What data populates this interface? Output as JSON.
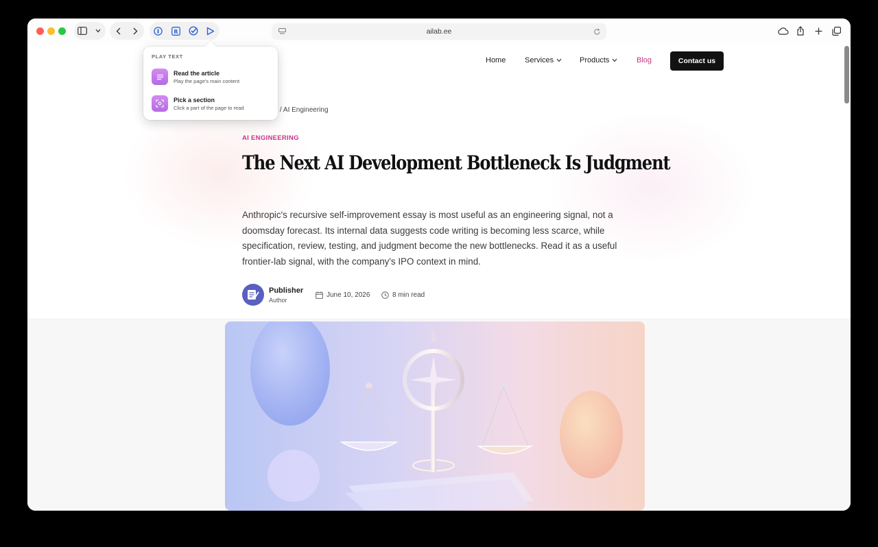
{
  "browser": {
    "url": "ailab.ee"
  },
  "popover": {
    "title": "PLAY TEXT",
    "items": [
      {
        "label": "Read the article",
        "description": "Play the page's main content"
      },
      {
        "label": "Pick a section",
        "description": "Click a part of the page to read"
      }
    ]
  },
  "site_nav": {
    "items": [
      {
        "label": "Home"
      },
      {
        "label": "Services"
      },
      {
        "label": "Products"
      },
      {
        "label": "Blog"
      }
    ],
    "cta_label": "Contact us"
  },
  "breadcrumb": {
    "visible_text": "og  /  AI Engineering"
  },
  "article": {
    "category": "AI ENGINEERING",
    "title": "The Next AI Development Bottleneck Is Judgment",
    "excerpt": "Anthropic's recursive self-improvement essay is most useful as an engineering signal, not a doomsday forecast. Its internal data suggests code writing is becoming less scarce, while specification, review, testing, and judgment become the new bottlenecks. Read it as a useful frontier-lab signal, with the company's IPO context in mind.",
    "author_name": "Publisher",
    "author_role": "Author",
    "date": "June 10, 2026",
    "read_time": "8 min read"
  },
  "colors": {
    "accent": "#c8338a",
    "cta_bg": "#121212",
    "popover_icon": "#c27ae9"
  },
  "icons": [
    "sidebar-icon",
    "chevron-down-icon",
    "back-icon",
    "forward-icon",
    "password-icon",
    "reader-icon",
    "check-icon",
    "play-icon",
    "page-icon",
    "reload-icon",
    "cloud-icon",
    "share-icon",
    "plus-icon",
    "tabs-icon",
    "lines-icon",
    "target-icon",
    "calendar-icon",
    "clock-icon"
  ]
}
